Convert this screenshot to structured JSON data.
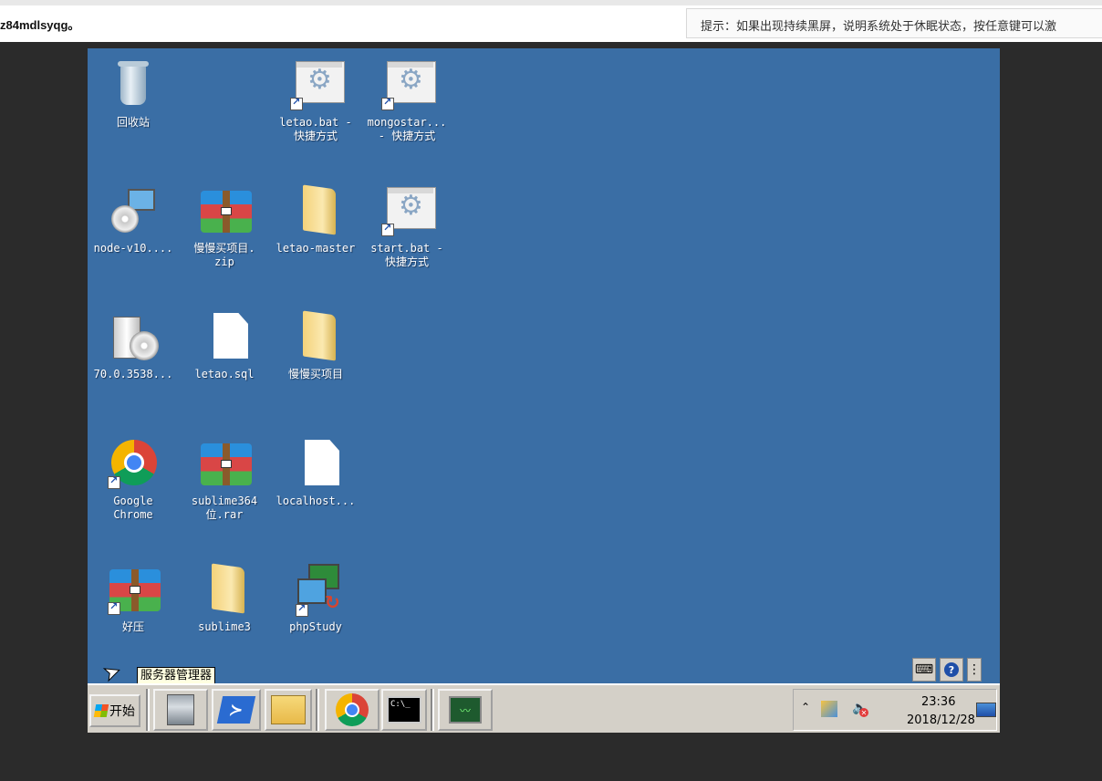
{
  "topbar": {
    "session_id_text": "z84mdlsyqg。",
    "hint_text": "提示：如果出现持续黑屏，说明系统处于休眠状态，按任意键可以激"
  },
  "desktop": {
    "background_color": "#3a6ea5",
    "icons": {
      "recycle_bin": {
        "label": "回收站",
        "icon": "recycle-bin-icon"
      },
      "letao_bat": {
        "label": "letao.bat -\n快捷方式",
        "icon": "batch-shortcut-icon",
        "shortcut": true
      },
      "mongostar": {
        "label": "mongostar...\n- 快捷方式",
        "icon": "batch-shortcut-icon",
        "shortcut": true
      },
      "node": {
        "label": "node-v10....",
        "icon": "installer-icon"
      },
      "manman_zip": {
        "label": "慢慢买项目.\nzip",
        "icon": "winrar-archive-icon"
      },
      "letao_master": {
        "label": "letao-master",
        "icon": "folder-icon"
      },
      "start_bat": {
        "label": "start.bat -\n快捷方式",
        "icon": "batch-shortcut-icon",
        "shortcut": true
      },
      "chrome_setup": {
        "label": "70.0.3538...",
        "icon": "setup-cd-icon"
      },
      "letao_sql": {
        "label": "letao.sql",
        "icon": "file-icon"
      },
      "manman_folder": {
        "label": "慢慢买项目",
        "icon": "folder-icon"
      },
      "google_chrome": {
        "label": "Google\nChrome",
        "icon": "chrome-icon",
        "shortcut": true
      },
      "sublime_rar": {
        "label": "sublime364\n位.rar",
        "icon": "winrar-archive-icon"
      },
      "localhost": {
        "label": "localhost...",
        "icon": "file-icon"
      },
      "haozip": {
        "label": "好压",
        "icon": "haozip-icon",
        "shortcut": true
      },
      "sublime3": {
        "label": "sublime3",
        "icon": "folder-icon"
      },
      "phpstudy": {
        "label": "phpStudy",
        "icon": "phpstudy-icon",
        "shortcut": true
      }
    },
    "tooltip_text": "服务器管理器",
    "rdp_bar": {
      "help_label": "?",
      "more_label": "⋮"
    }
  },
  "taskbar": {
    "start_label": "开始",
    "buttons": [
      "server-manager",
      "powershell",
      "windows-explorer",
      "google-chrome",
      "command-prompt",
      "task-manager"
    ],
    "cmd_text": "C:\\_",
    "tray": {
      "clock_time": "23:36",
      "clock_date": "2018/12/28",
      "volume_muted": true
    }
  }
}
